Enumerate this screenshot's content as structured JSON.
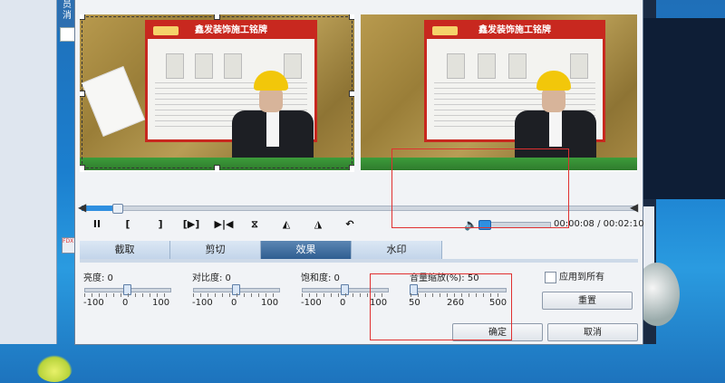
{
  "background": {
    "left_tab_text": "员\n消",
    "mini_icon_text": "FDX"
  },
  "controls": {
    "pause": "II",
    "mark_in": "[",
    "mark_out": "]",
    "play_range": "[▶]",
    "next_frame": "▶|◀",
    "flip_vertical": "⧖",
    "rotate_left": "◭",
    "rotate_right": "◮",
    "undo": "↶",
    "volume_icon": "speaker-icon",
    "time_display": "00:00:08 / 00:02:10",
    "seek_progress_fraction": 0.06,
    "volume_level_fraction": 0.08
  },
  "poster": {
    "title": "鑫发装饰施工铭牌"
  },
  "tabs": [
    {
      "label": "截取",
      "active": false
    },
    {
      "label": "剪切",
      "active": false
    },
    {
      "label": "效果",
      "active": true
    },
    {
      "label": "水印",
      "active": false
    }
  ],
  "sliders": {
    "brightness": {
      "label": "亮度: 0",
      "ticks": [
        "-100",
        "0",
        "100"
      ],
      "value": 0
    },
    "contrast": {
      "label": "对比度: 0",
      "ticks": [
        "-100",
        "0",
        "100"
      ],
      "value": 0
    },
    "saturation": {
      "label": "饱和度: 0",
      "ticks": [
        "-100",
        "0",
        "100"
      ],
      "value": 0
    },
    "volume_zoom": {
      "label": "音量缩放(%): 50",
      "ticks": [
        "50",
        "260",
        "500"
      ],
      "value": 50
    }
  },
  "apply_all_label": "应用到所有",
  "buttons": {
    "reset": "重置",
    "ok": "确定",
    "cancel": "取消"
  },
  "colors": {
    "accent": "#2f8fe0",
    "tab_active": "#2f5e91",
    "annotation_red": "#e03030"
  }
}
